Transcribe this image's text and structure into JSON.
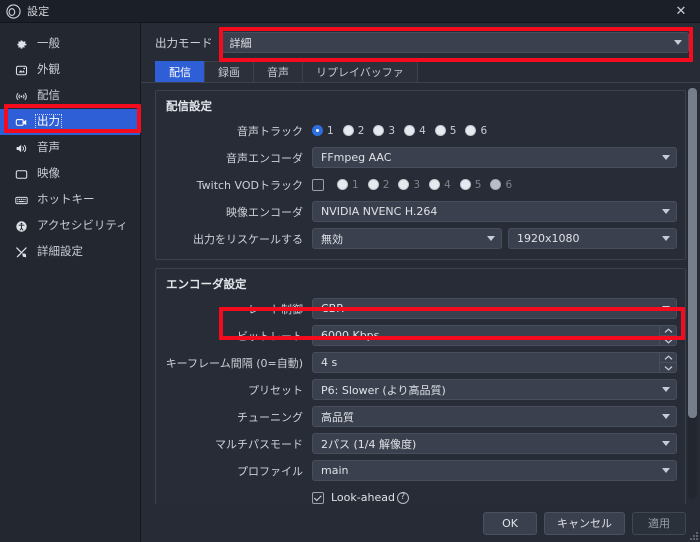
{
  "window": {
    "title": "設定",
    "logo_icon": "obs-logo-icon",
    "close_label": "✕"
  },
  "sidebar": {
    "items": [
      {
        "label": "一般",
        "icon": "gear-icon",
        "key": "general",
        "selected": false
      },
      {
        "label": "外観",
        "icon": "appearance-icon",
        "key": "appearance",
        "selected": false
      },
      {
        "label": "配信",
        "icon": "broadcast-icon",
        "key": "stream",
        "selected": false
      },
      {
        "label": "出力",
        "icon": "output-icon",
        "key": "output",
        "selected": true
      },
      {
        "label": "音声",
        "icon": "speaker-icon",
        "key": "audio",
        "selected": false
      },
      {
        "label": "映像",
        "icon": "monitor-icon",
        "key": "video",
        "selected": false
      },
      {
        "label": "ホットキー",
        "icon": "keyboard-icon",
        "key": "hotkeys",
        "selected": false
      },
      {
        "label": "アクセシビリティ",
        "icon": "accessibility-icon",
        "key": "accessibility",
        "selected": false
      },
      {
        "label": "詳細設定",
        "icon": "tools-icon",
        "key": "advanced",
        "selected": false
      }
    ]
  },
  "output_mode": {
    "label": "出力モード",
    "value": "詳細"
  },
  "tabs": [
    {
      "label": "配信",
      "active": true
    },
    {
      "label": "録画",
      "active": false
    },
    {
      "label": "音声",
      "active": false
    },
    {
      "label": "リプレイバッファ",
      "active": false
    }
  ],
  "stream_group": {
    "title": "配信設定",
    "audio_track": {
      "label": "音声トラック",
      "options": [
        "1",
        "2",
        "3",
        "4",
        "5",
        "6"
      ],
      "selected": "1"
    },
    "audio_encoder": {
      "label": "音声エンコーダ",
      "value": "FFmpeg AAC"
    },
    "twitch_vod": {
      "label": "Twitch VODトラック",
      "checked": false,
      "options": [
        "1",
        "2",
        "3",
        "4",
        "5",
        "6"
      ],
      "selected": "6",
      "enabled": false
    },
    "video_encoder": {
      "label": "映像エンコーダ",
      "value": "NVIDIA NVENC H.264"
    },
    "rescale": {
      "label": "出力をリスケールする",
      "value": "無効",
      "resolution": "1920x1080"
    }
  },
  "encoder_group": {
    "title": "エンコーダ設定",
    "rate_control": {
      "label": "レート制御",
      "value": "CBR"
    },
    "bitrate": {
      "label": "ビットレート",
      "value": "6000 Kbps"
    },
    "keyframe": {
      "label": "キーフレーム間隔 (0=自動)",
      "value": "4 s"
    },
    "preset": {
      "label": "プリセット",
      "value": "P6: Slower (より高品質)"
    },
    "tuning": {
      "label": "チューニング",
      "value": "高品質"
    },
    "multipass": {
      "label": "マルチパスモード",
      "value": "2パス (1/4 解像度)"
    },
    "profile": {
      "label": "プロファイル",
      "value": "main"
    },
    "lookahead": {
      "label": "Look-ahead",
      "checked": true,
      "help_icon": "help-circle-icon"
    }
  },
  "footer": {
    "ok": "OK",
    "cancel": "キャンセル",
    "apply": "適用"
  },
  "annotations": {
    "color": "#f40c1e",
    "boxes": [
      "output-mode-row",
      "sidebar-item-output",
      "bitrate-row"
    ]
  },
  "theme": {
    "accent": "#2e5fd6",
    "window_bg": "#262b35",
    "sidebar_bg": "#232830",
    "field_bg": "#3a404d",
    "titlebar_bg": "#1b1f27"
  }
}
